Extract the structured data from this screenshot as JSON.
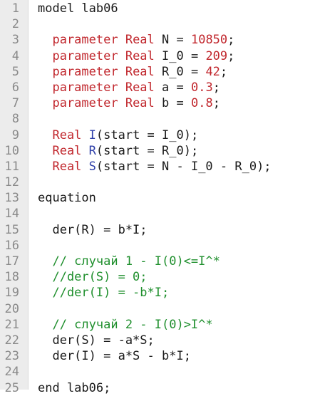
{
  "editor": {
    "line_numbers": [
      "1",
      "2",
      "3",
      "4",
      "5",
      "6",
      "7",
      "8",
      "9",
      "10",
      "11",
      "12",
      "13",
      "14",
      "15",
      "16",
      "17",
      "18",
      "19",
      "20",
      "21",
      "22",
      "23",
      "24",
      "25"
    ],
    "lines": [
      [
        {
          "t": "model lab06",
          "c": "plain"
        }
      ],
      [],
      [
        {
          "t": "  parameter ",
          "c": "kw"
        },
        {
          "t": "Real ",
          "c": "kw"
        },
        {
          "t": "N = ",
          "c": "plain"
        },
        {
          "t": "10850",
          "c": "num"
        },
        {
          "t": ";",
          "c": "plain"
        }
      ],
      [
        {
          "t": "  parameter ",
          "c": "kw"
        },
        {
          "t": "Real ",
          "c": "kw"
        },
        {
          "t": "I_0 = ",
          "c": "plain"
        },
        {
          "t": "209",
          "c": "num"
        },
        {
          "t": ";",
          "c": "plain"
        }
      ],
      [
        {
          "t": "  parameter ",
          "c": "kw"
        },
        {
          "t": "Real ",
          "c": "kw"
        },
        {
          "t": "R_0 = ",
          "c": "plain"
        },
        {
          "t": "42",
          "c": "num"
        },
        {
          "t": ";",
          "c": "plain"
        }
      ],
      [
        {
          "t": "  parameter ",
          "c": "kw"
        },
        {
          "t": "Real ",
          "c": "kw"
        },
        {
          "t": "a = ",
          "c": "plain"
        },
        {
          "t": "0.3",
          "c": "num"
        },
        {
          "t": ";",
          "c": "plain"
        }
      ],
      [
        {
          "t": "  parameter ",
          "c": "kw"
        },
        {
          "t": "Real ",
          "c": "kw"
        },
        {
          "t": "b = ",
          "c": "plain"
        },
        {
          "t": "0.8",
          "c": "num"
        },
        {
          "t": ";",
          "c": "plain"
        }
      ],
      [],
      [
        {
          "t": "  Real ",
          "c": "kw"
        },
        {
          "t": "I",
          "c": "var"
        },
        {
          "t": "(start = I_0);",
          "c": "plain"
        }
      ],
      [
        {
          "t": "  Real ",
          "c": "kw"
        },
        {
          "t": "R",
          "c": "var"
        },
        {
          "t": "(start = R_0);",
          "c": "plain"
        }
      ],
      [
        {
          "t": "  Real ",
          "c": "kw"
        },
        {
          "t": "S",
          "c": "var"
        },
        {
          "t": "(start = N - I_0 - R_0);",
          "c": "plain"
        }
      ],
      [],
      [
        {
          "t": "equation",
          "c": "plain"
        }
      ],
      [],
      [
        {
          "t": "  der(R) = b*I;",
          "c": "plain"
        }
      ],
      [],
      [
        {
          "t": "  // случай 1 - I(0)<=I^*",
          "c": "cm"
        }
      ],
      [
        {
          "t": "  //der(S) = 0;",
          "c": "cm"
        }
      ],
      [
        {
          "t": "  //der(I) = -b*I;",
          "c": "cm"
        }
      ],
      [],
      [
        {
          "t": "  // случай 2 - I(0)>I^*",
          "c": "cm"
        }
      ],
      [
        {
          "t": "  der(S) = -a*S;",
          "c": "plain"
        }
      ],
      [
        {
          "t": "  der(I) = a*S - b*I;",
          "c": "plain"
        }
      ],
      [],
      [
        {
          "t": "end lab06;",
          "c": "plain"
        }
      ]
    ]
  },
  "colors": {
    "keyword": "#c1272d",
    "variable": "#2d3ea8",
    "comment": "#1f8f2d",
    "gutter_bg": "#ececec",
    "line_number": "#8a8a8a"
  }
}
